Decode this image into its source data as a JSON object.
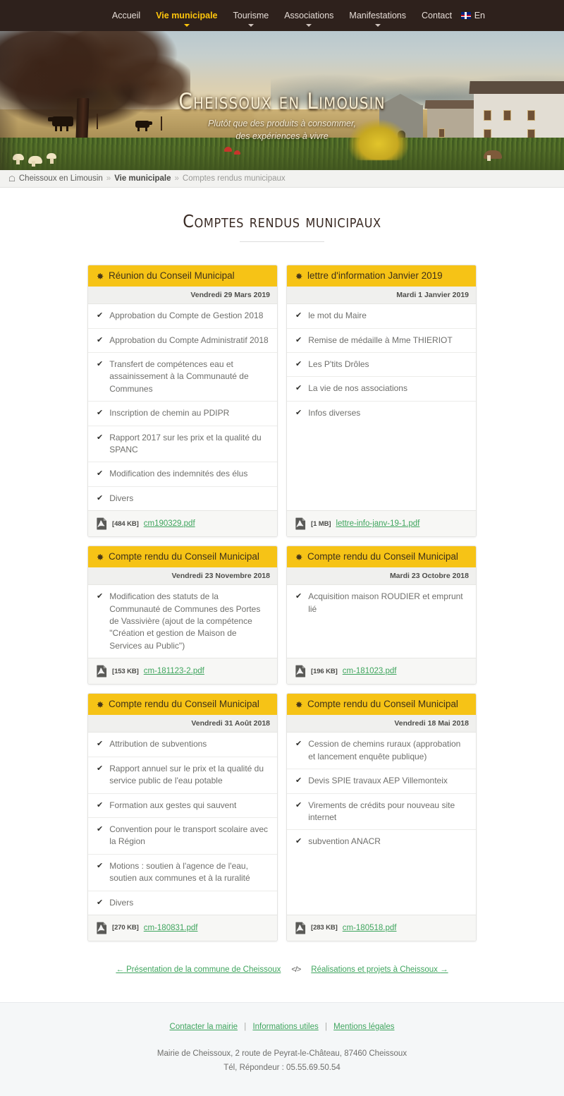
{
  "nav": {
    "items": [
      {
        "label": "Accueil",
        "active": false,
        "caret": false
      },
      {
        "label": "Vie municipale",
        "active": true,
        "caret": true
      },
      {
        "label": "Tourisme",
        "active": false,
        "caret": true
      },
      {
        "label": "Associations",
        "active": false,
        "caret": true
      },
      {
        "label": "Manifestations",
        "active": false,
        "caret": true
      },
      {
        "label": "Contact",
        "active": false,
        "caret": false
      }
    ],
    "lang_label": "En",
    "lang_icon": "uk-flag-icon",
    "active_color": "#ffc60b",
    "bar_color": "#2e211c"
  },
  "hero": {
    "title": "Cheissoux en Limousin",
    "subtitle_line1": "Plutôt que des produits à consommer,",
    "subtitle_line2": "des expériences à vivre"
  },
  "breadcrumb": {
    "home_icon": "home-icon",
    "items": [
      {
        "label": "Cheissoux en Limousin",
        "bold": false,
        "current": false
      },
      {
        "label": "Vie municipale",
        "bold": true,
        "current": false
      },
      {
        "label": "Comptes rendus municipaux",
        "bold": false,
        "current": true
      }
    ],
    "separator": "»"
  },
  "page": {
    "title": "Comptes rendus municipaux"
  },
  "cards": [
    {
      "title": "Réunion du Conseil Municipal",
      "icon": "gear-icon",
      "date": "Vendredi 29 Mars 2019",
      "items": [
        "Approbation du Compte de Gestion 2018",
        "Approbation du Compte Administratif 2018",
        "Transfert de compétences eau et assainissement à la Communauté de Communes",
        "Inscription de chemin au PDIPR",
        "Rapport 2017 sur les prix et la qualité du SPANC",
        "Modification des indemnités des élus",
        "Divers"
      ],
      "file_size": "[484 KB]",
      "file_name": "cm190329.pdf"
    },
    {
      "title": "lettre d'information Janvier 2019",
      "icon": "gear-icon",
      "date": "Mardi 1 Janvier 2019",
      "items": [
        "le mot du Maire",
        "Remise de médaille à Mme THIERIOT",
        "Les P'tits Drôles",
        "La vie de nos associations",
        "Infos diverses"
      ],
      "file_size": "[1 MB]",
      "file_name": "lettre-info-janv-19-1.pdf"
    },
    {
      "title": "Compte rendu du Conseil Municipal",
      "icon": "gear-icon",
      "date": "Vendredi 23 Novembre 2018",
      "items": [
        "Modification des statuts de la Communauté de Communes des Portes de Vassivière (ajout de la compétence \"Création et gestion de Maison de Services au Public\")"
      ],
      "file_size": "[153 KB]",
      "file_name": "cm-181123-2.pdf"
    },
    {
      "title": "Compte rendu du Conseil Municipal",
      "icon": "gear-icon",
      "date": "Mardi 23 Octobre 2018",
      "items": [
        "Acquisition maison ROUDIER et emprunt lié"
      ],
      "file_size": "[196 KB]",
      "file_name": "cm-181023.pdf"
    },
    {
      "title": "Compte rendu du Conseil Municipal",
      "icon": "gear-icon",
      "date": "Vendredi 31 Août 2018",
      "items": [
        "Attribution de subventions",
        "Rapport annuel sur le prix et la qualité du service public de l'eau potable",
        "Formation aux gestes qui sauvent",
        "Convention pour le transport scolaire avec la Région",
        "Motions : soutien à l'agence de l'eau, soutien aux communes et à la ruralité",
        "Divers"
      ],
      "file_size": "[270 KB]",
      "file_name": "cm-180831.pdf"
    },
    {
      "title": "Compte rendu du Conseil Municipal",
      "icon": "gear-icon",
      "date": "Vendredi 18 Mai 2018",
      "items": [
        "Cession de chemins ruraux (approbation et lancement enquête publique)",
        "Devis SPIE travaux AEP Villemonteix",
        "Virements de crédits pour nouveau site internet",
        "subvention ANACR"
      ],
      "file_size": "[283 KB]",
      "file_name": "cm-180518.pdf"
    }
  ],
  "pager": {
    "prev_arrow": "←",
    "prev_label": "Présentation de la commune de Cheissoux",
    "middle_icon": "</>",
    "next_label": "Réalisations et projets à Cheissoux",
    "next_arrow": "→"
  },
  "footer": {
    "link1": "Contacter la mairie",
    "link2": "Informations utiles",
    "link3": "Mentions légales",
    "separator": "|",
    "address": "Mairie de Cheissoux, 2 route de Peyrat-le-Château, 87460 Cheissoux",
    "phone": "Tél, Répondeur : 05.55.69.50.54"
  },
  "colors": {
    "card_header": "#f6c316",
    "link_green": "#3fa55e",
    "nav_bg": "#2e211c",
    "accent_yellow": "#ffc60b"
  }
}
